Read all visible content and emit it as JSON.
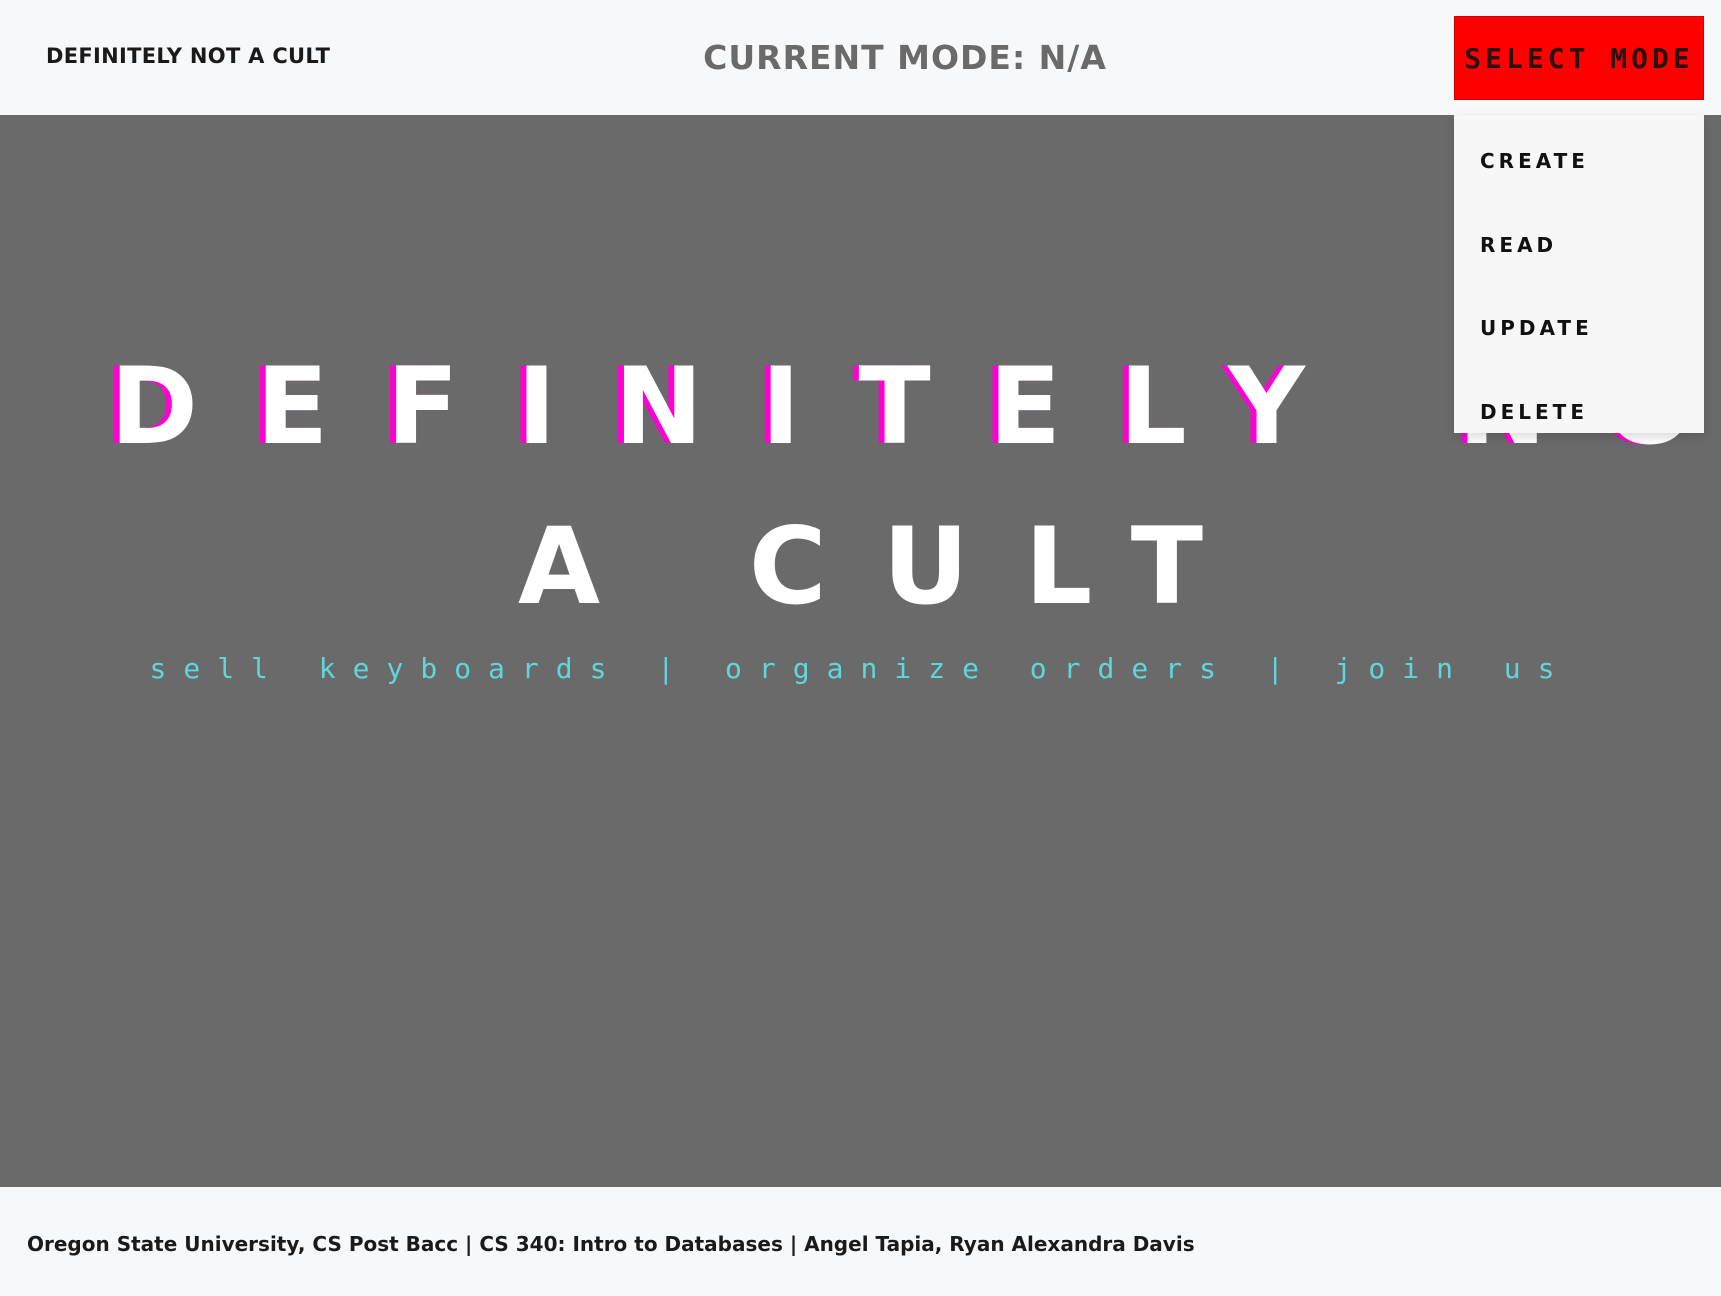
{
  "header": {
    "brand": "DEFINITELY NOT A CULT",
    "current_mode": "CURRENT MODE: N/A",
    "select_mode_label": "SELECT MODE"
  },
  "dropdown": {
    "items": [
      {
        "label": "CREATE"
      },
      {
        "label": "READ"
      },
      {
        "label": "UPDATE"
      },
      {
        "label": "DELETE"
      }
    ]
  },
  "hero": {
    "title_line1": "DEFINITELY NOT",
    "title_line2": "A CULT",
    "tagline": "sell keyboards | organize orders | join us"
  },
  "footer": {
    "text": "Oregon State University, CS Post Bacc | CS 340: Intro to Databases | Angel Tapia, Ryan Alexandra Davis"
  },
  "colors": {
    "hero_background": "#6a6a6a",
    "select_button": "#ff0000",
    "glitch_accent": "#ff00d4",
    "tagline": "#5fd6dc"
  }
}
